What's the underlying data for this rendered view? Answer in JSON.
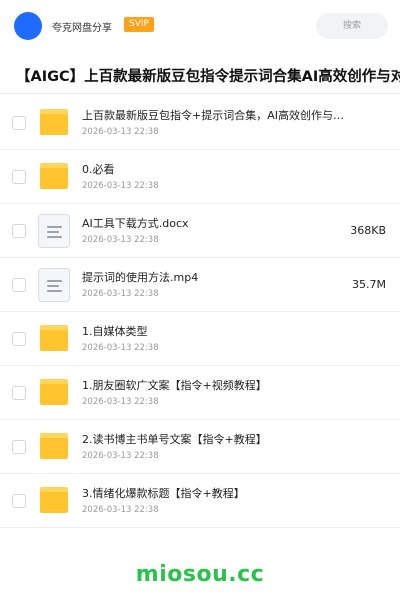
{
  "header": {
    "share_name": "夸克网盘分享",
    "badge": "SVIP",
    "search_label": "搜索"
  },
  "title": "【AIGC】上百款最新版豆包指令提示词合集AI高效创作与对",
  "files": [
    {
      "type": "folder",
      "name": "上百款最新版豆包指令+提示词合集，AI高效创作与对话技巧",
      "date": "2026-03-13 22:38",
      "size": ""
    },
    {
      "type": "folder",
      "name": "0.必看",
      "date": "2026-03-13 22:38",
      "size": ""
    },
    {
      "type": "doc",
      "name": "AI工具下载方式.docx",
      "date": "2026-03-13 22:38",
      "size": "368KB"
    },
    {
      "type": "doc",
      "name": "提示词的使用方法.mp4",
      "date": "2026-03-13 22:38",
      "size": "35.7M"
    },
    {
      "type": "folder",
      "name": "1.自媒体类型",
      "date": "2026-03-13 22:38",
      "size": ""
    },
    {
      "type": "folder",
      "name": "1.朋友圈软广文案【指令+视频教程】",
      "date": "2026-03-13 22:38",
      "size": ""
    },
    {
      "type": "folder",
      "name": "2.读书博主书单号文案【指令+教程】",
      "date": "2026-03-13 22:38",
      "size": ""
    },
    {
      "type": "folder",
      "name": "3.情绪化爆款标题【指令+教程】",
      "date": "2026-03-13 22:38",
      "size": ""
    }
  ],
  "watermark": "miosou.cc",
  "colors": {
    "accent": "#1f6bff",
    "badge": "#ffa21a",
    "folder": "#ffc42e",
    "watermark": "#29c24a"
  }
}
